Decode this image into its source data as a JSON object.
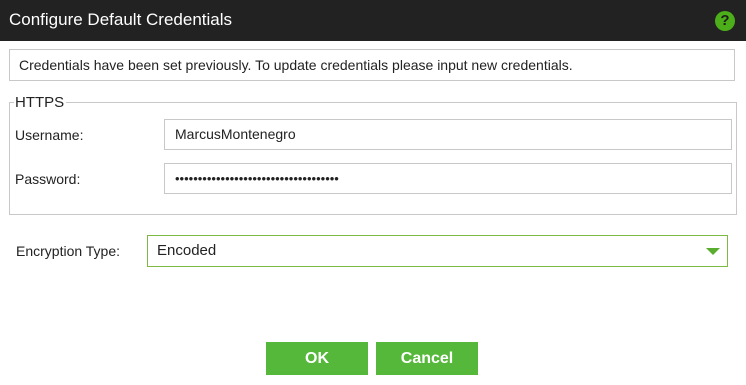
{
  "dialog": {
    "title": "Configure Default Credentials",
    "help_symbol": "?"
  },
  "info_message": "Credentials have been set previously. To update credentials please input new credentials.",
  "https": {
    "legend": "HTTPS",
    "username_label": "Username:",
    "username_value": "MarcusMontenegro",
    "password_label": "Password:",
    "password_value": "••••••••••••••••••••••••••••••••••••"
  },
  "encryption": {
    "label": "Encryption Type:",
    "selected": "Encoded"
  },
  "buttons": {
    "ok": "OK",
    "cancel": "Cancel"
  },
  "colors": {
    "titlebar": "#222222",
    "accent_green": "#56b83a",
    "help_icon": "#4caf1a"
  },
  "icons": {
    "help": "help-icon",
    "dropdown": "chevron-down-icon"
  }
}
